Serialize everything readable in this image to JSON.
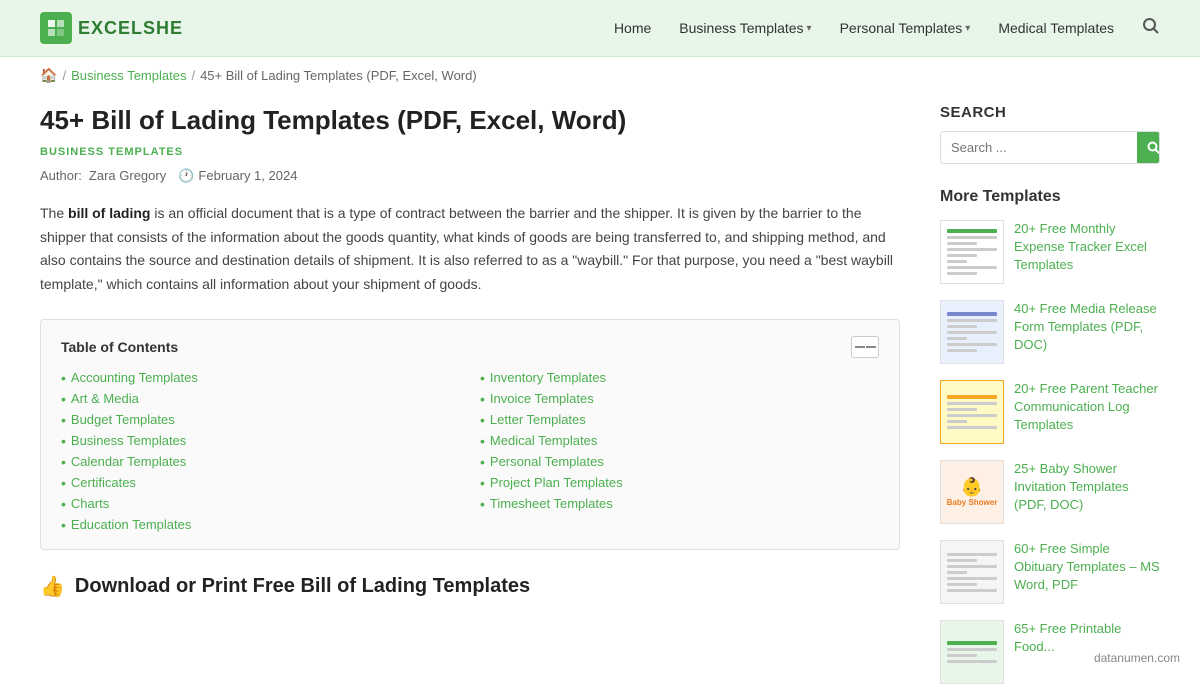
{
  "header": {
    "logo_text": "EXCELSHE",
    "nav": [
      {
        "label": "Home",
        "has_dropdown": false
      },
      {
        "label": "Business Templates",
        "has_dropdown": true
      },
      {
        "label": "Personal Templates",
        "has_dropdown": true
      },
      {
        "label": "Medical Templates",
        "has_dropdown": false
      }
    ],
    "search_placeholder": "Search ..."
  },
  "breadcrumb": {
    "home_icon": "🏠",
    "items": [
      {
        "label": "Business Templates",
        "href": "#"
      },
      {
        "label": "45+ Bill of Lading Templates (PDF, Excel, Word)",
        "href": "#"
      }
    ]
  },
  "article": {
    "title": "45+ Bill of Lading Templates (PDF, Excel, Word)",
    "category": "BUSINESS TEMPLATES",
    "author_label": "Author:",
    "author": "Zara Gregory",
    "date_icon": "🕐",
    "date": "February 1, 2024",
    "body": "The bill of lading is an official document that is a type of contract between the barrier and the shipper. It is given by the barrier to the shipper that consists of the information about the goods quantity, what kinds of goods are being transferred to, and shipping method, and also contains the source and destination details of shipment. It is also referred to as a \"waybill.\" For that purpose, you need a \"best waybill template,\" which contains all information about your shipment of goods.",
    "bold_phrase": "bill of lading"
  },
  "toc": {
    "title": "Table of Contents",
    "items": [
      {
        "label": "Accounting Templates",
        "href": "#"
      },
      {
        "label": "Art & Media",
        "href": "#"
      },
      {
        "label": "Budget Templates",
        "href": "#"
      },
      {
        "label": "Business Templates",
        "href": "#"
      },
      {
        "label": "Calendar Templates",
        "href": "#"
      },
      {
        "label": "Certificates",
        "href": "#"
      },
      {
        "label": "Charts",
        "href": "#"
      },
      {
        "label": "Education Templates",
        "href": "#"
      },
      {
        "label": "Inventory Templates",
        "href": "#"
      },
      {
        "label": "Invoice Templates",
        "href": "#"
      },
      {
        "label": "Letter Templates",
        "href": "#"
      },
      {
        "label": "Medical Templates",
        "href": "#"
      },
      {
        "label": "Personal Templates",
        "href": "#"
      },
      {
        "label": "Project Plan Templates",
        "href": "#"
      },
      {
        "label": "Timesheet Templates",
        "href": "#"
      }
    ]
  },
  "download_section": {
    "icon": "👍",
    "title": "Download or Print Free Bill of Lading Templates"
  },
  "sidebar": {
    "search_label": "SEARCH",
    "search_placeholder": "Search ...",
    "more_templates_label": "More Templates",
    "templates": [
      {
        "title": "20+ Free Monthly Expense Tracker Excel Templates",
        "thumb_type": "spreadsheet"
      },
      {
        "title": "40+ Free Media Release Form Templates (PDF, DOC)",
        "thumb_type": "document"
      },
      {
        "title": "20+ Free Parent Teacher Communication Log Templates",
        "thumb_type": "green-header"
      },
      {
        "title": "25+ Baby Shower Invitation Templates (PDF, DOC)",
        "thumb_type": "baby"
      },
      {
        "title": "60+ Free Simple Obituary Templates – MS Word, PDF",
        "thumb_type": "text-doc"
      },
      {
        "title": "65+ Free Printable Food...",
        "thumb_type": "food"
      }
    ]
  },
  "footer": {
    "brand": "datanumen.com"
  }
}
